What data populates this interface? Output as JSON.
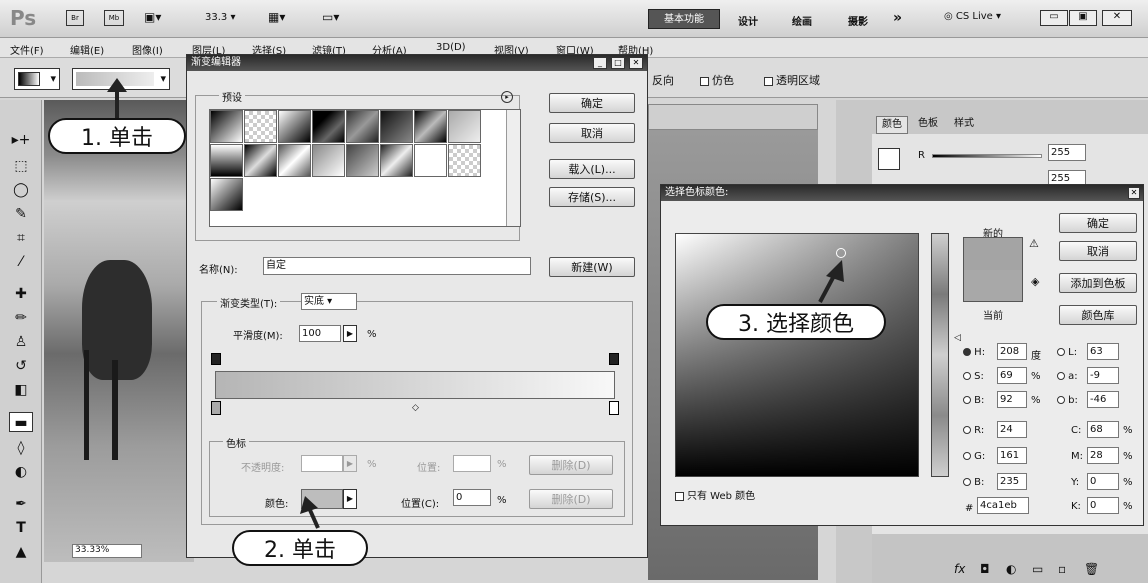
{
  "app": {
    "logo": "Ps",
    "zoom": "33.3",
    "workspace_active": "基本功能",
    "workspaces": [
      "设计",
      "绘画",
      "摄影"
    ],
    "more": "»",
    "cslive": "CS Live"
  },
  "menu": [
    "文件(F)",
    "编辑(E)",
    "图像(I)",
    "图层(L)",
    "选择(S)",
    "滤镜(T)",
    "分析(A)",
    "3D(D)",
    "视图(V)",
    "窗口(W)",
    "帮助(H)"
  ],
  "options": {
    "reverse": "反向",
    "dither": "仿色",
    "transparency": "透明区域"
  },
  "canvas": {
    "zoom_status": "33.33%"
  },
  "gradient_editor": {
    "title": "渐变编辑器",
    "presets_label": "预设",
    "ok": "确定",
    "cancel": "取消",
    "load": "载入(L)...",
    "save": "存储(S)...",
    "name_label": "名称(N):",
    "name_value": "自定",
    "new": "新建(W)",
    "type_label": "渐变类型(T):",
    "type_value": "实底",
    "smooth_label": "平滑度(M):",
    "smooth_value": "100",
    "percent": "%",
    "stops_label": "色标",
    "opacity_label": "不透明度:",
    "location_label": "位置:",
    "delete": "删除(D)",
    "color_label": "颜色:",
    "location_c_label": "位置(C):",
    "location_c_value": "0"
  },
  "color_picker": {
    "title": "选择色标颜色:",
    "new_label": "新的",
    "current_label": "当前",
    "ok": "确定",
    "cancel": "取消",
    "add_swatch": "添加到色板",
    "libraries": "颜色库",
    "web_only": "只有 Web 颜色",
    "H": "208",
    "H_unit": "度",
    "S": "69",
    "B": "92",
    "R": "24",
    "G": "161",
    "Bv": "235",
    "L": "63",
    "a": "-9",
    "b": "-46",
    "C": "68",
    "M": "28",
    "Y": "0",
    "K": "0",
    "hex": "4ca1eb",
    "new_color": "#a4a4a4",
    "current_color": "#a8a8a8"
  },
  "color_panel": {
    "tabs": [
      "颜色",
      "色板",
      "样式"
    ],
    "R_label": "R",
    "R_value": "255",
    "G_value": "255"
  },
  "callouts": {
    "c1": "1. 单击",
    "c2": "2. 单击",
    "c3": "3. 选择颜色"
  }
}
